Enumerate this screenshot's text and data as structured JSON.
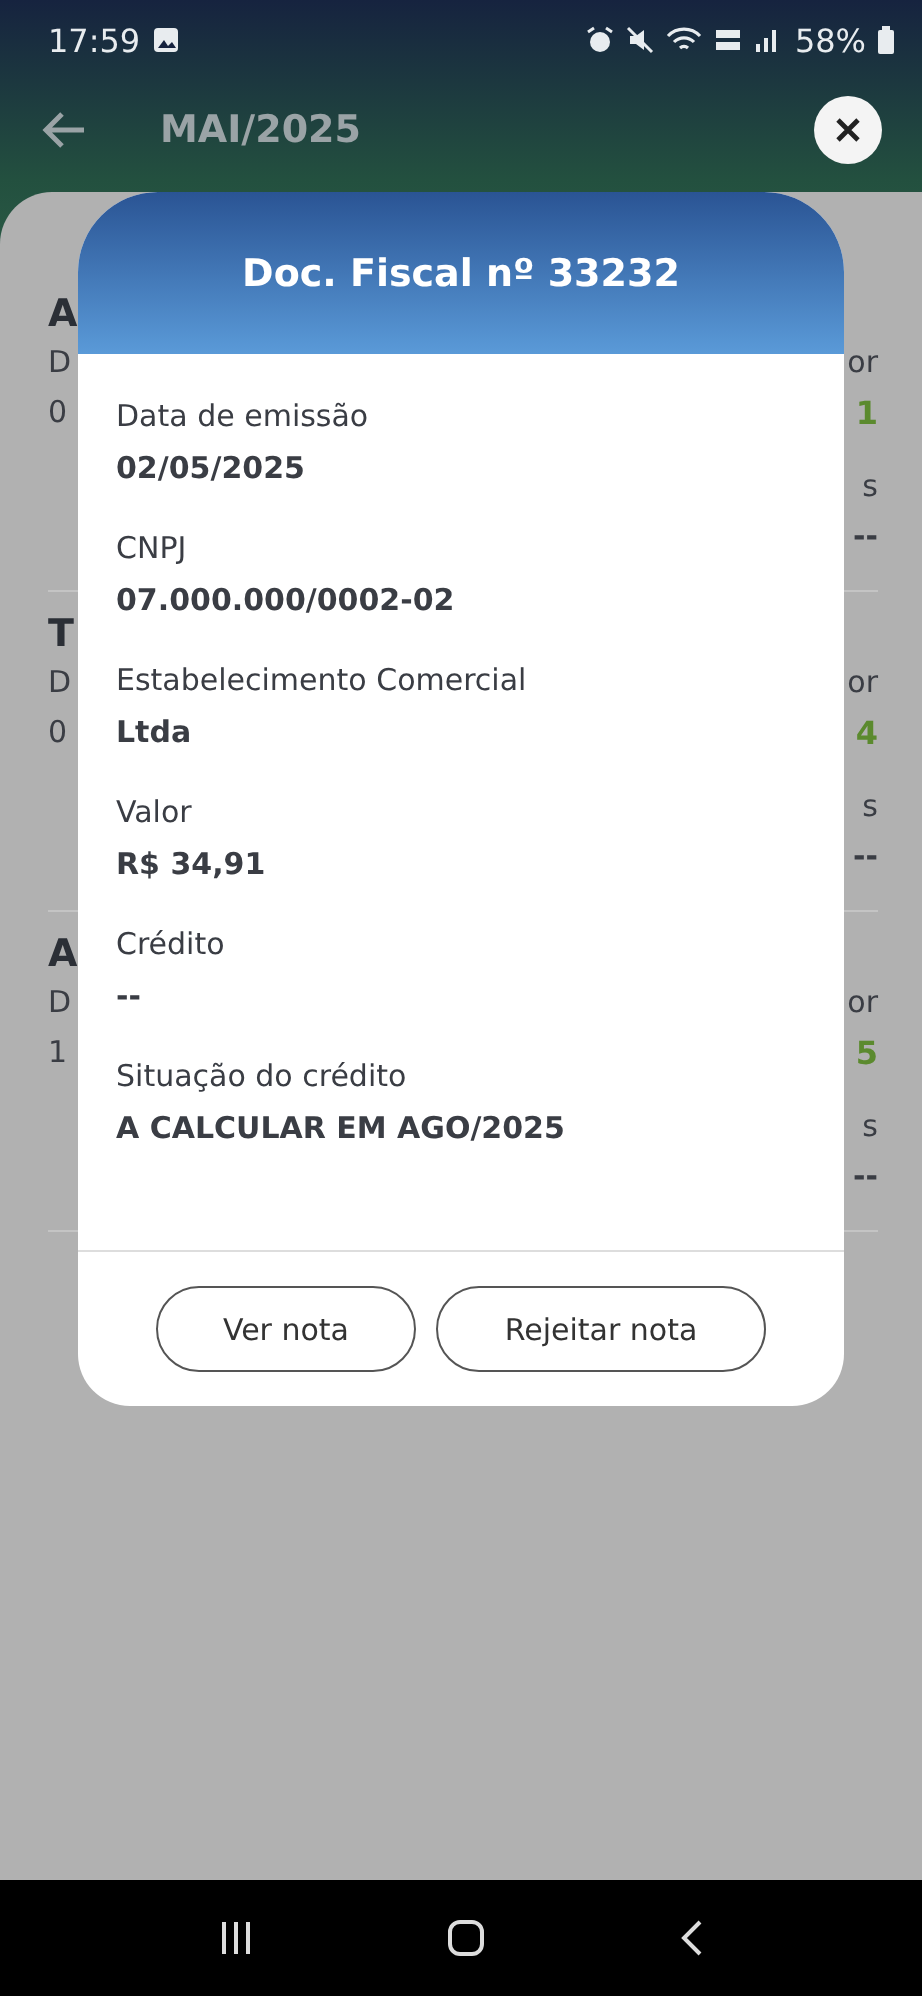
{
  "status_bar": {
    "time": "17:59",
    "battery": "58%"
  },
  "header": {
    "title": "MAI/2025"
  },
  "background_rows": [
    {
      "title": "A",
      "label": "D",
      "date": "0",
      "value_label": "or",
      "value": "1",
      "credits_label": "s",
      "credits": "--"
    },
    {
      "title": "T",
      "label": "D",
      "date": "0",
      "value_label": "or",
      "value": "4",
      "credits_label": "s",
      "credits": "--"
    },
    {
      "title": "A",
      "label": "D",
      "date": "1",
      "value_label": "or",
      "value": "5",
      "credits_label": "s",
      "credits": "--"
    }
  ],
  "dialog": {
    "title": "Doc. Fiscal nº 33232",
    "fields": [
      {
        "label": "Data de emissão",
        "value": "02/05/2025"
      },
      {
        "label": "CNPJ",
        "value": "07.000.000/0002-02"
      },
      {
        "label": "Estabelecimento Comercial",
        "value": "Ltda"
      },
      {
        "label": "Valor",
        "value": "R$ 34,91"
      },
      {
        "label": "Crédito",
        "value": "--"
      },
      {
        "label": "Situação do crédito",
        "value": "A CALCULAR EM AGO/2025"
      }
    ],
    "buttons": [
      "Ver nota",
      "Rejeitar nota"
    ]
  }
}
